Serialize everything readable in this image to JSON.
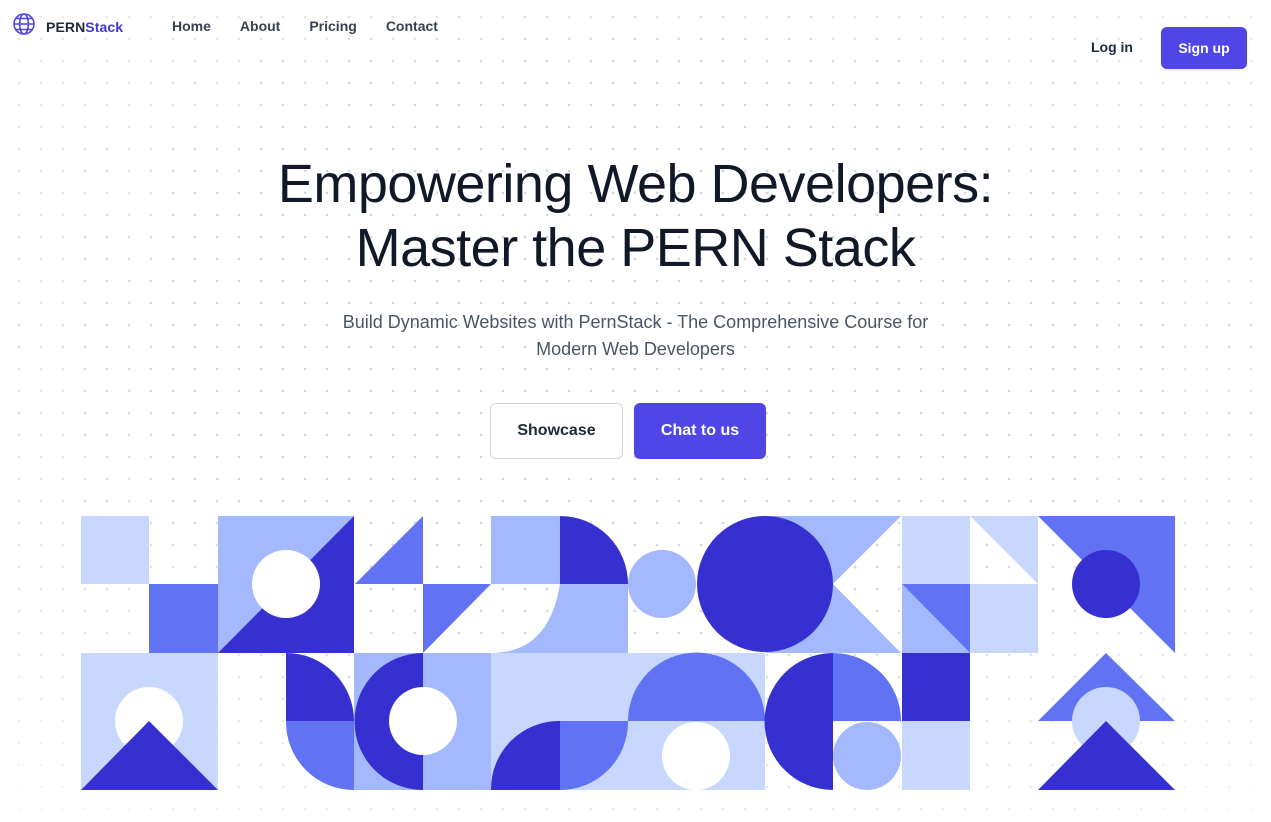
{
  "brand": {
    "name_part1": "PERN",
    "name_part2": "Stack",
    "icon": "globe-icon"
  },
  "nav": {
    "links": [
      "Home",
      "About",
      "Pricing",
      "Contact"
    ],
    "login_label": "Log in",
    "signup_label": "Sign up"
  },
  "hero": {
    "title_line1": "Empowering Web Developers:",
    "title_line2": "Master the PERN Stack",
    "subtitle": "Build Dynamic Websites with PernStack - The Comprehensive Course for Modern Web Developers"
  },
  "cta": {
    "showcase_label": "Showcase",
    "chat_label": "Chat to us"
  },
  "colors": {
    "primary": "#4f46e5",
    "pattern_dark": "#3730d1",
    "pattern_mid": "#6172f3",
    "pattern_light": "#a3b8fd",
    "pattern_pale": "#c7d7fe"
  }
}
